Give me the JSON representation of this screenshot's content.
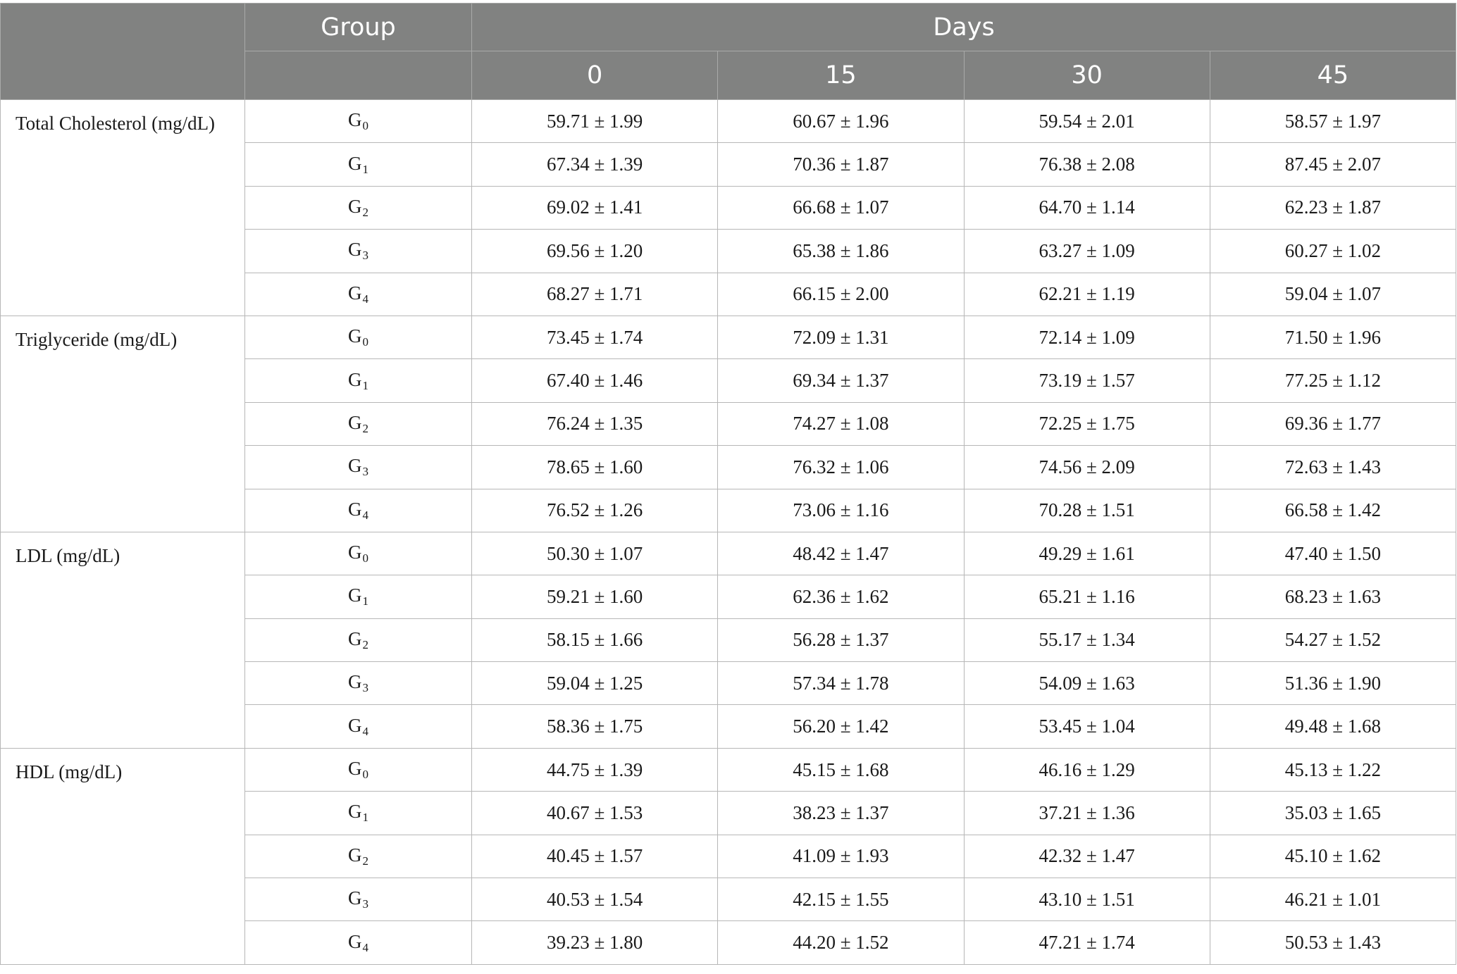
{
  "header": {
    "group_label": "Group",
    "days_label": "Days",
    "day_columns": [
      "0",
      "15",
      "30",
      "45"
    ]
  },
  "groups": [
    {
      "prefix": "G",
      "sub": "0"
    },
    {
      "prefix": "G",
      "sub": "1"
    },
    {
      "prefix": "G",
      "sub": "2"
    },
    {
      "prefix": "G",
      "sub": "3"
    },
    {
      "prefix": "G",
      "sub": "4"
    }
  ],
  "parameters": [
    {
      "label": "Total Cholesterol (mg/dL)",
      "rows": [
        [
          "59.71 ± 1.99",
          "60.67 ± 1.96",
          "59.54 ± 2.01",
          "58.57 ± 1.97"
        ],
        [
          "67.34 ± 1.39",
          "70.36 ± 1.87",
          "76.38 ± 2.08",
          "87.45 ± 2.07"
        ],
        [
          "69.02 ± 1.41",
          "66.68 ± 1.07",
          "64.70 ± 1.14",
          "62.23 ± 1.87"
        ],
        [
          "69.56 ± 1.20",
          "65.38 ± 1.86",
          "63.27 ± 1.09",
          "60.27 ± 1.02"
        ],
        [
          "68.27 ± 1.71",
          "66.15 ± 2.00",
          "62.21 ± 1.19",
          "59.04 ± 1.07"
        ]
      ]
    },
    {
      "label": "Triglyceride (mg/dL)",
      "rows": [
        [
          "73.45 ± 1.74",
          "72.09 ± 1.31",
          "72.14 ± 1.09",
          "71.50 ± 1.96"
        ],
        [
          "67.40 ± 1.46",
          "69.34 ± 1.37",
          "73.19 ± 1.57",
          "77.25 ± 1.12"
        ],
        [
          "76.24 ± 1.35",
          "74.27 ± 1.08",
          "72.25 ± 1.75",
          "69.36 ± 1.77"
        ],
        [
          "78.65 ± 1.60",
          "76.32 ± 1.06",
          "74.56 ± 2.09",
          "72.63 ± 1.43"
        ],
        [
          "76.52 ± 1.26",
          "73.06 ± 1.16",
          "70.28 ± 1.51",
          "66.58 ± 1.42"
        ]
      ]
    },
    {
      "label": "LDL (mg/dL)",
      "rows": [
        [
          "50.30 ± 1.07",
          "48.42 ± 1.47",
          "49.29 ± 1.61",
          "47.40 ± 1.50"
        ],
        [
          "59.21 ± 1.60",
          "62.36 ± 1.62",
          "65.21 ± 1.16",
          "68.23 ± 1.63"
        ],
        [
          "58.15 ± 1.66",
          "56.28 ± 1.37",
          "55.17 ± 1.34",
          "54.27 ± 1.52"
        ],
        [
          "59.04 ± 1.25",
          "57.34 ± 1.78",
          "54.09 ± 1.63",
          "51.36 ± 1.90"
        ],
        [
          "58.36 ± 1.75",
          "56.20 ± 1.42",
          "53.45 ± 1.04",
          "49.48 ± 1.68"
        ]
      ]
    },
    {
      "label": "HDL (mg/dL)",
      "rows": [
        [
          "44.75 ± 1.39",
          "45.15 ± 1.68",
          "46.16 ± 1.29",
          "45.13 ± 1.22"
        ],
        [
          "40.67 ± 1.53",
          "38.23 ± 1.37",
          "37.21 ± 1.36",
          "35.03 ± 1.65"
        ],
        [
          "40.45 ± 1.57",
          "41.09 ± 1.93",
          "42.32 ± 1.47",
          "45.10 ± 1.62"
        ],
        [
          "40.53 ± 1.54",
          "42.15 ± 1.55",
          "43.10 ± 1.51",
          "46.21 ± 1.01"
        ],
        [
          "39.23 ± 1.80",
          "44.20 ± 1.52",
          "47.21 ± 1.74",
          "50.53 ± 1.43"
        ]
      ]
    }
  ]
}
